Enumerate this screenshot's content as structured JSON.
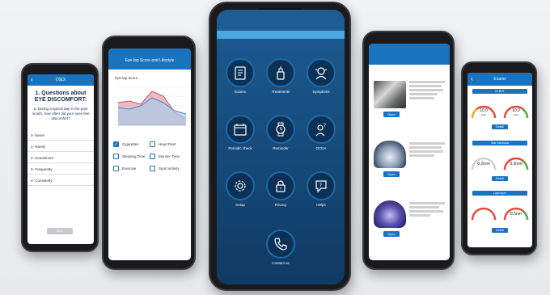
{
  "phone_questionnaire": {
    "header_title": "OSDI",
    "question_title": "1. Questions about EYE DISCOMFORT:",
    "question_text": "a. During a typical day in the past month, how often did your eyes feel discomfort?",
    "options": [
      "0- Never",
      "1- Rarely",
      "2- Sometimes",
      "3- Frequently",
      "4- Constantly"
    ],
    "next_label": "Next"
  },
  "phone_lifestyle": {
    "header_title": "Eye-lap Score and Lifestyle",
    "chart_title": "Eye-lap Score",
    "checkboxes": [
      {
        "label": "Cigarettes",
        "checked": true
      },
      {
        "label": "Head Rest",
        "checked": false
      },
      {
        "label": "Sleeping Time",
        "checked": false
      },
      {
        "label": "Monitor Time",
        "checked": false
      },
      {
        "label": "Exercise",
        "checked": false
      },
      {
        "label": "Sport activity",
        "checked": false
      }
    ]
  },
  "phone_main": {
    "tiles": [
      {
        "label": "Exams",
        "icon": "clipboard-icon"
      },
      {
        "label": "Treatments",
        "icon": "dropper-bottle-icon"
      },
      {
        "label": "Symptoms",
        "icon": "head-pain-icon"
      },
      {
        "label": "Periodic check",
        "icon": "calendar-icon"
      },
      {
        "label": "Reminder",
        "icon": "watch-icon"
      },
      {
        "label": "OCDA",
        "icon": "person-question-icon"
      },
      {
        "label": "Setup",
        "icon": "gear-icon"
      },
      {
        "label": "Privacy",
        "icon": "lock-icon"
      },
      {
        "label": "Helps",
        "icon": "help-icon"
      },
      {
        "label": "Contact us",
        "icon": "phone-icon"
      }
    ]
  },
  "phone_images": {
    "open_label": "Open"
  },
  "phone_exams": {
    "header_title": "Exams",
    "sections": [
      {
        "title": "NI-BUT",
        "values": [
          "10.0",
          "10.0"
        ],
        "units": [
          "secs",
          "secs"
        ]
      },
      {
        "title": "Tear meniscus",
        "values": [
          "0.2mm",
          "0.3mm"
        ],
        "units": [
          "",
          ""
        ]
      },
      {
        "title": "Lipid layer",
        "values": [
          "8.5nm",
          "8.5nm"
        ],
        "units": [
          "",
          ""
        ]
      }
    ],
    "detail_label": "Detail"
  },
  "colors": {
    "accent": "#1a73be",
    "main_bg": "#123f6b",
    "phone_body": "#1a1a1c"
  }
}
